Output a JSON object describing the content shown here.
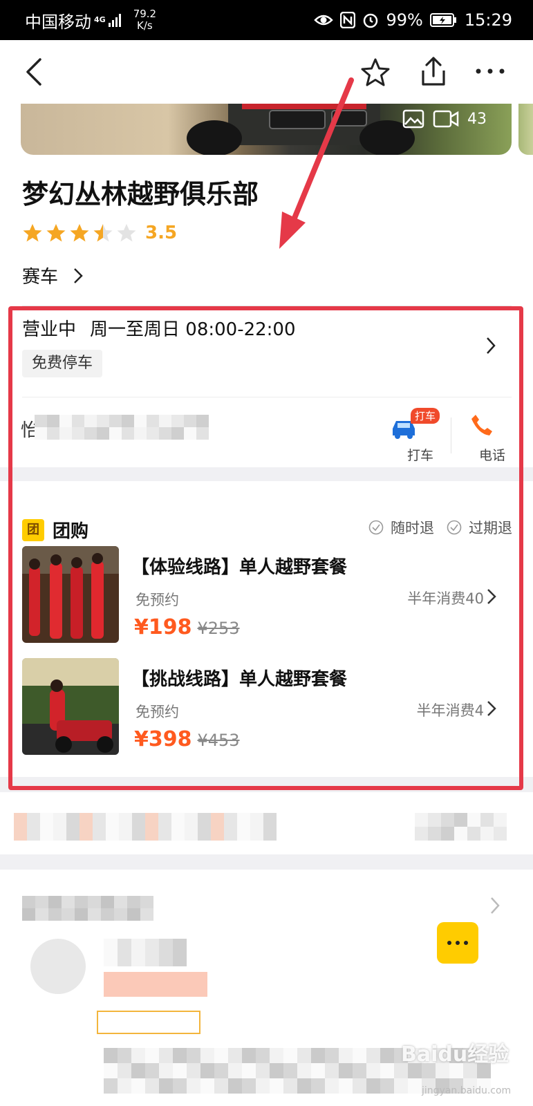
{
  "status_bar": {
    "carrier": "中国移动",
    "network": "4G",
    "speed": "79.2",
    "speed_unit": "K/s",
    "battery": "99%",
    "time": "15:29"
  },
  "hero": {
    "media_count": "43"
  },
  "shop": {
    "name": "梦幻丛林越野俱乐部",
    "rating": 3.5,
    "rating_text": "3.5",
    "category": "赛车"
  },
  "info": {
    "status": "营业中",
    "hours": "周一至周日 08:00-22:00",
    "tag": "免费停车",
    "address_partial": "怡*路*",
    "taxi_badge": "打车",
    "taxi_label": "打车",
    "phone_label": "电话"
  },
  "groupbuy": {
    "badge": "团",
    "title": "团购",
    "policies": [
      "随时退",
      "过期退"
    ],
    "deals": [
      {
        "title": "【体验线路】单人越野套餐",
        "note": "免预约",
        "sales": "半年消费40",
        "price": "¥198",
        "original_price": "¥253"
      },
      {
        "title": "【挑战线路】单人越野套餐",
        "note": "免预约",
        "sales": "半年消费4",
        "price": "¥398",
        "original_price": "¥453"
      }
    ]
  },
  "watermark": {
    "text": "Baidu经验",
    "sub": "jingyan.baidu.com"
  },
  "colors": {
    "accent_orange": "#ff5a1f",
    "star": "#f5a623",
    "annotation_red": "#e53948",
    "taxi_blue": "#1e6fd9"
  }
}
